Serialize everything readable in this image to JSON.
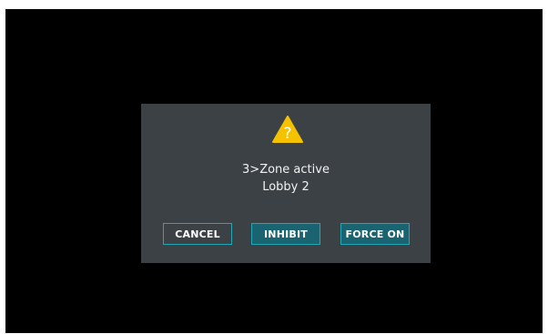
{
  "dialog": {
    "icon": "warning-icon",
    "icon_glyph": "?",
    "icon_color": "#f5c200",
    "message_line_1": "3>Zone active",
    "message_line_2": "Lobby 2",
    "buttons": {
      "cancel": "CANCEL",
      "inhibit": "INHIBIT",
      "force_on": "FORCE ON"
    }
  },
  "colors": {
    "background": "#000000",
    "dialog_bg": "#3c4146",
    "accent": "#22a7b6",
    "button_fill": "#1a6472"
  }
}
